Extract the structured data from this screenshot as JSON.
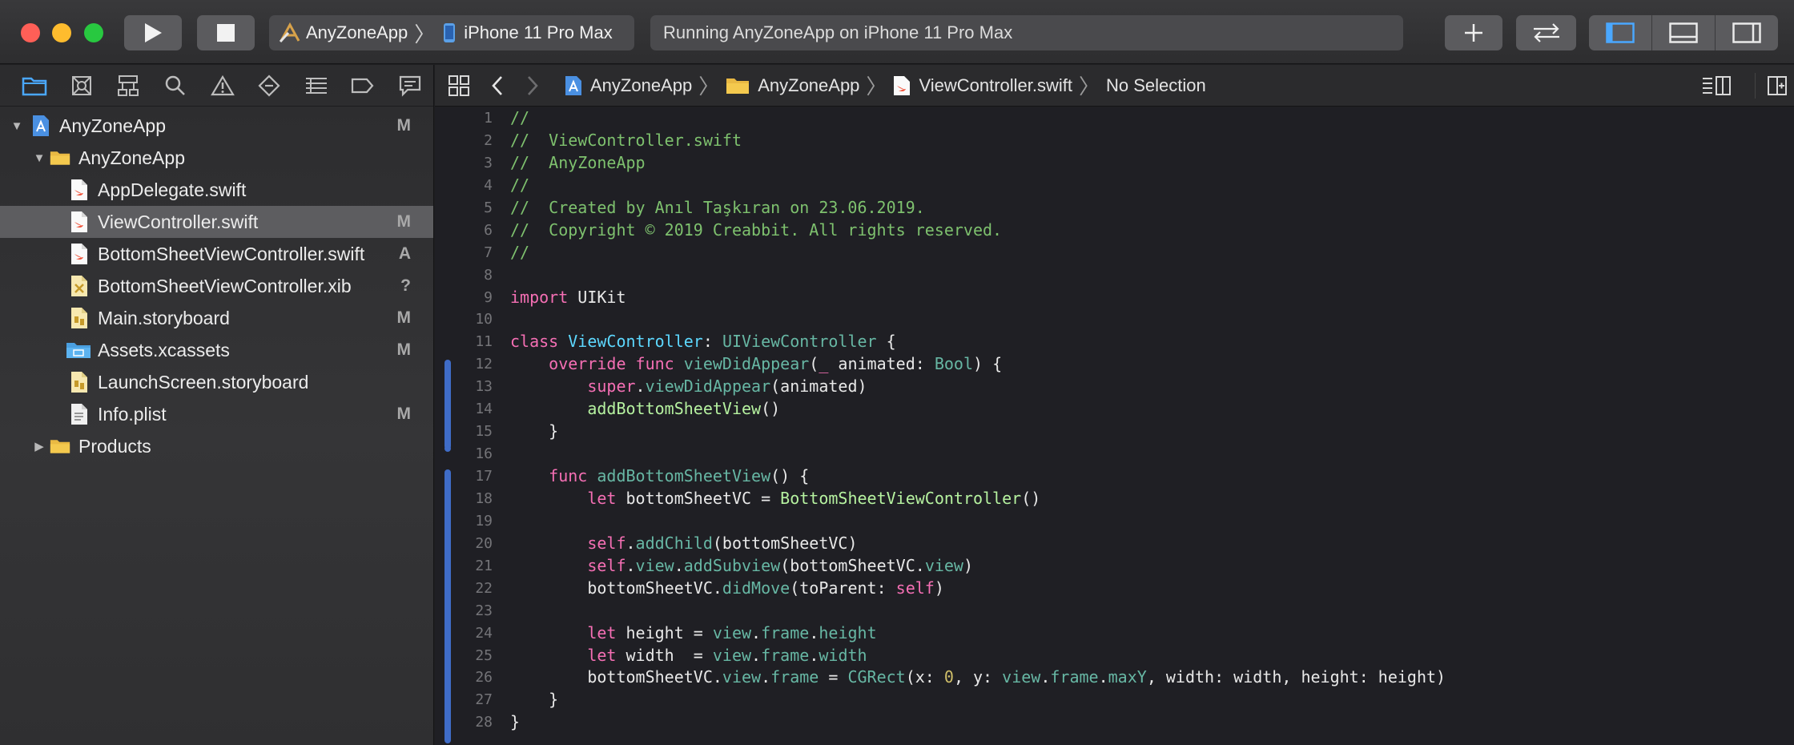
{
  "toolbar": {
    "scheme_name": "AnyZoneApp",
    "scheme_device": "iPhone 11 Pro Max",
    "status": "Running AnyZoneApp on iPhone 11 Pro Max"
  },
  "navigator": {
    "tabs": [
      "folder-icon",
      "source-control-icon",
      "hierarchy-icon",
      "search-icon",
      "warning-icon",
      "test-icon",
      "debug-icon",
      "breakpoint-icon",
      "report-icon"
    ],
    "items": [
      {
        "label": "AnyZoneApp",
        "badge": "M",
        "depth": 0,
        "disclosure": "expanded",
        "icon": "project-icon",
        "selected": false
      },
      {
        "label": "AnyZoneApp",
        "badge": "",
        "depth": 1,
        "disclosure": "expanded",
        "icon": "folder-icon",
        "selected": false
      },
      {
        "label": "AppDelegate.swift",
        "badge": "",
        "depth": 2,
        "disclosure": "",
        "icon": "swift-file-icon",
        "selected": false
      },
      {
        "label": "ViewController.swift",
        "badge": "M",
        "depth": 2,
        "disclosure": "",
        "icon": "swift-file-icon",
        "selected": true
      },
      {
        "label": "BottomSheetViewController.swift",
        "badge": "A",
        "depth": 2,
        "disclosure": "",
        "icon": "swift-file-icon",
        "selected": false
      },
      {
        "label": "BottomSheetViewController.xib",
        "badge": "?",
        "depth": 2,
        "disclosure": "",
        "icon": "xib-file-icon",
        "selected": false
      },
      {
        "label": "Main.storyboard",
        "badge": "M",
        "depth": 2,
        "disclosure": "",
        "icon": "storyboard-file-icon",
        "selected": false
      },
      {
        "label": "Assets.xcassets",
        "badge": "M",
        "depth": 2,
        "disclosure": "",
        "icon": "assets-folder-icon",
        "selected": false
      },
      {
        "label": "LaunchScreen.storyboard",
        "badge": "",
        "depth": 2,
        "disclosure": "",
        "icon": "storyboard-file-icon",
        "selected": false
      },
      {
        "label": "Info.plist",
        "badge": "M",
        "depth": 2,
        "disclosure": "",
        "icon": "plist-file-icon",
        "selected": false
      },
      {
        "label": "Products",
        "badge": "",
        "depth": 1,
        "disclosure": "collapsed",
        "icon": "folder-icon",
        "selected": false
      }
    ]
  },
  "jumpbar": {
    "crumbs": [
      "AnyZoneApp",
      "AnyZoneApp",
      "ViewController.swift",
      "No Selection"
    ]
  },
  "editor": {
    "colors": {
      "comment": "#7ec16e",
      "keyword": "#f56fb4",
      "declaration": "#5dd8ff",
      "type": "#d0a8ff",
      "change_bar": "#3f6cc7"
    },
    "lines": [
      {
        "n": "1",
        "tokens": [
          {
            "t": "//",
            "c": "comment"
          }
        ]
      },
      {
        "n": "2",
        "tokens": [
          {
            "t": "//  ViewController.swift",
            "c": "comment"
          }
        ]
      },
      {
        "n": "3",
        "tokens": [
          {
            "t": "//  AnyZoneApp",
            "c": "comment"
          }
        ]
      },
      {
        "n": "4",
        "tokens": [
          {
            "t": "//",
            "c": "comment"
          }
        ]
      },
      {
        "n": "5",
        "tokens": [
          {
            "t": "//  Created by Anıl Taşkıran on 23.06.2019.",
            "c": "comment"
          }
        ]
      },
      {
        "n": "6",
        "tokens": [
          {
            "t": "//  Copyright © 2019 Creabbit. All rights reserved.",
            "c": "comment"
          }
        ]
      },
      {
        "n": "7",
        "tokens": [
          {
            "t": "//",
            "c": "comment"
          }
        ]
      },
      {
        "n": "8",
        "tokens": []
      },
      {
        "n": "9",
        "tokens": [
          {
            "t": "import",
            "c": "kw"
          },
          {
            "t": " UIKit",
            "c": "plain"
          }
        ]
      },
      {
        "n": "10",
        "tokens": []
      },
      {
        "n": "11",
        "tokens": [
          {
            "t": "class",
            "c": "kw"
          },
          {
            "t": " ",
            "c": "plain"
          },
          {
            "t": "ViewController",
            "c": "decl"
          },
          {
            "t": ": ",
            "c": "plain"
          },
          {
            "t": "UIViewController",
            "c": "decl2"
          },
          {
            "t": " {",
            "c": "plain"
          }
        ]
      },
      {
        "n": "12",
        "tokens": [
          {
            "t": "    override func",
            "c": "kw"
          },
          {
            "t": " ",
            "c": "plain"
          },
          {
            "t": "viewDidAppear",
            "c": "decl2"
          },
          {
            "t": "(",
            "c": "plain"
          },
          {
            "t": "_",
            "c": "kw"
          },
          {
            "t": " animated: ",
            "c": "plain"
          },
          {
            "t": "Bool",
            "c": "decl2"
          },
          {
            "t": ") {",
            "c": "plain"
          }
        ]
      },
      {
        "n": "13",
        "tokens": [
          {
            "t": "        super",
            "c": "kw"
          },
          {
            "t": ".",
            "c": "plain"
          },
          {
            "t": "viewDidAppear",
            "c": "decl2"
          },
          {
            "t": "(animated)",
            "c": "plain"
          }
        ]
      },
      {
        "n": "14",
        "tokens": [
          {
            "t": "        addBottomSheetView",
            "c": "cls"
          },
          {
            "t": "()",
            "c": "plain"
          }
        ]
      },
      {
        "n": "15",
        "tokens": [
          {
            "t": "    }",
            "c": "plain"
          }
        ]
      },
      {
        "n": "16",
        "tokens": []
      },
      {
        "n": "17",
        "tokens": [
          {
            "t": "    func",
            "c": "kw"
          },
          {
            "t": " ",
            "c": "plain"
          },
          {
            "t": "addBottomSheetView",
            "c": "decl2"
          },
          {
            "t": "() {",
            "c": "plain"
          }
        ]
      },
      {
        "n": "18",
        "tokens": [
          {
            "t": "        let",
            "c": "kw"
          },
          {
            "t": " bottomSheetVC = ",
            "c": "plain"
          },
          {
            "t": "BottomSheetViewController",
            "c": "cls"
          },
          {
            "t": "()",
            "c": "plain"
          }
        ]
      },
      {
        "n": "19",
        "tokens": []
      },
      {
        "n": "20",
        "tokens": [
          {
            "t": "        self",
            "c": "kw"
          },
          {
            "t": ".",
            "c": "plain"
          },
          {
            "t": "addChild",
            "c": "decl2"
          },
          {
            "t": "(bottomSheetVC)",
            "c": "plain"
          }
        ]
      },
      {
        "n": "21",
        "tokens": [
          {
            "t": "        self",
            "c": "kw"
          },
          {
            "t": ".",
            "c": "plain"
          },
          {
            "t": "view",
            "c": "decl2"
          },
          {
            "t": ".",
            "c": "plain"
          },
          {
            "t": "addSubview",
            "c": "decl2"
          },
          {
            "t": "(bottomSheetVC.",
            "c": "plain"
          },
          {
            "t": "view",
            "c": "decl2"
          },
          {
            "t": ")",
            "c": "plain"
          }
        ]
      },
      {
        "n": "22",
        "tokens": [
          {
            "t": "        bottomSheetVC.",
            "c": "plain"
          },
          {
            "t": "didMove",
            "c": "decl2"
          },
          {
            "t": "(toParent: ",
            "c": "plain"
          },
          {
            "t": "self",
            "c": "kw"
          },
          {
            "t": ")",
            "c": "plain"
          }
        ]
      },
      {
        "n": "23",
        "tokens": []
      },
      {
        "n": "24",
        "tokens": [
          {
            "t": "        let",
            "c": "kw"
          },
          {
            "t": " height = ",
            "c": "plain"
          },
          {
            "t": "view",
            "c": "decl2"
          },
          {
            "t": ".",
            "c": "plain"
          },
          {
            "t": "frame",
            "c": "decl2"
          },
          {
            "t": ".",
            "c": "plain"
          },
          {
            "t": "height",
            "c": "decl2"
          }
        ]
      },
      {
        "n": "25",
        "tokens": [
          {
            "t": "        let",
            "c": "kw"
          },
          {
            "t": " width  = ",
            "c": "plain"
          },
          {
            "t": "view",
            "c": "decl2"
          },
          {
            "t": ".",
            "c": "plain"
          },
          {
            "t": "frame",
            "c": "decl2"
          },
          {
            "t": ".",
            "c": "plain"
          },
          {
            "t": "width",
            "c": "decl2"
          }
        ]
      },
      {
        "n": "26",
        "tokens": [
          {
            "t": "        bottomSheetVC.",
            "c": "plain"
          },
          {
            "t": "view",
            "c": "decl2"
          },
          {
            "t": ".",
            "c": "plain"
          },
          {
            "t": "frame",
            "c": "decl2"
          },
          {
            "t": " = ",
            "c": "plain"
          },
          {
            "t": "CGRect",
            "c": "decl2"
          },
          {
            "t": "(x: ",
            "c": "plain"
          },
          {
            "t": "0",
            "c": "num"
          },
          {
            "t": ", y: ",
            "c": "plain"
          },
          {
            "t": "view",
            "c": "decl2"
          },
          {
            "t": ".",
            "c": "plain"
          },
          {
            "t": "frame",
            "c": "decl2"
          },
          {
            "t": ".",
            "c": "plain"
          },
          {
            "t": "maxY",
            "c": "decl2"
          },
          {
            "t": ", width: width, height: height)",
            "c": "plain"
          }
        ]
      },
      {
        "n": "27",
        "tokens": [
          {
            "t": "    }",
            "c": "plain"
          }
        ]
      },
      {
        "n": "28",
        "tokens": [
          {
            "t": "}",
            "c": "plain"
          }
        ]
      }
    ]
  }
}
